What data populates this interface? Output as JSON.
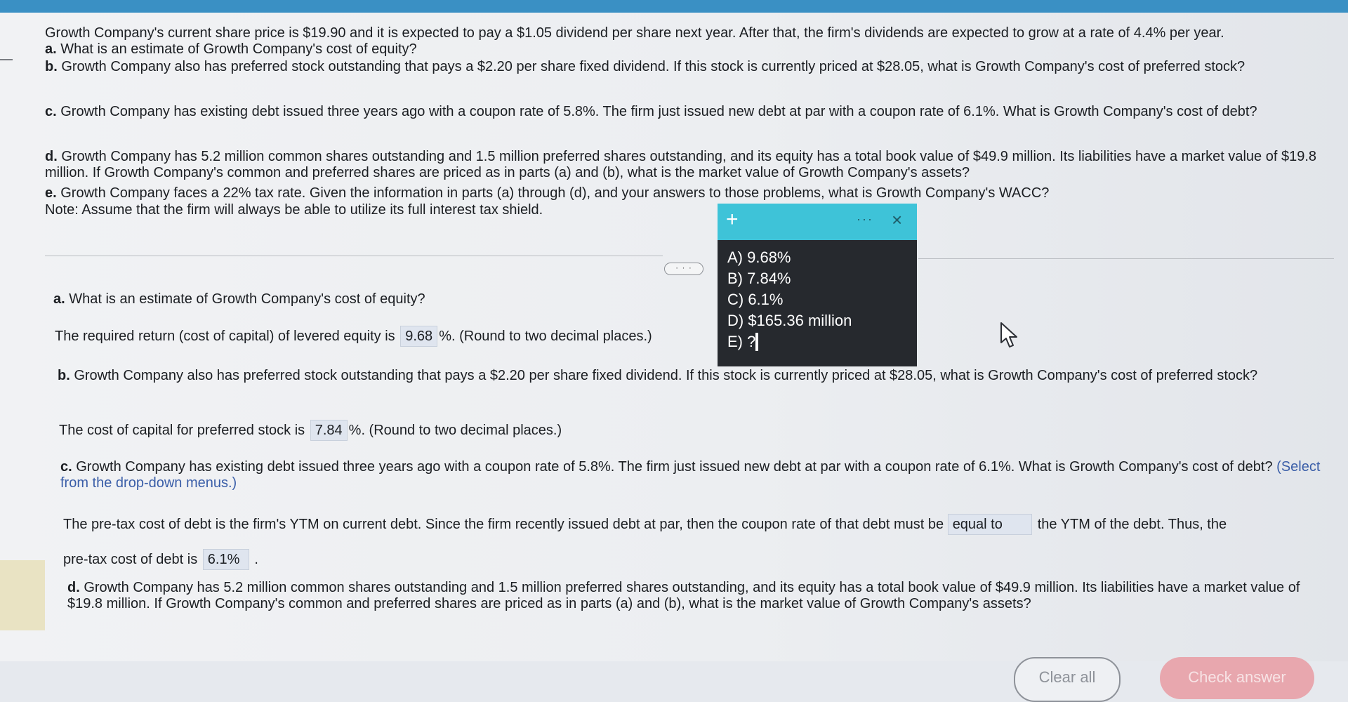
{
  "question": {
    "intro": "Growth Company's current share price is $19.90 and it is expected to pay a $1.05 dividend per share next year. After that, the firm's dividends are expected to grow at a rate of 4.4% per year.",
    "part_a_label": "a.",
    "part_a": "What is an estimate of Growth Company's cost of equity?",
    "part_b_label": "b.",
    "part_b": "Growth Company also has preferred stock outstanding that pays a $2.20 per share fixed dividend. If this stock is currently priced at $28.05, what is Growth Company's cost of preferred stock?",
    "part_c_label": "c.",
    "part_c": "Growth Company has existing debt issued three years ago with a coupon rate of 5.8%. The firm just issued new debt at par with a coupon rate of 6.1%. What is Growth Company's cost of debt?",
    "part_d_label": "d.",
    "part_d": "Growth Company has 5.2 million common shares outstanding and 1.5 million preferred shares outstanding, and its equity has a total book value of $49.9 million. Its liabilities have a market value of $19.8 million. If Growth Company's common and preferred shares are priced as in parts (a) and (b), what is the market value of Growth Company's assets?",
    "part_e_label": "e.",
    "part_e": "Growth Company faces a 22% tax rate. Given the information in parts (a) through (d), and your answers to those problems, what is Growth Company's WACC?",
    "note": "Note: Assume that the firm will always be able to utilize its full interest tax shield."
  },
  "more_pill": "· · ·",
  "answers": {
    "a_label": "a.",
    "a_question": "What is an estimate of Growth Company's cost of equity?",
    "a_prefix": "The required return (cost of capital) of levered equity is",
    "a_value": "9.68",
    "a_suffix": "%.  (Round to two decimal places.)",
    "b_label": "b.",
    "b_question": "Growth Company also has preferred stock outstanding that pays a $2.20 per share fixed dividend. If this stock is currently priced at $28.05, what is Growth Company's cost of preferred stock?",
    "b_prefix": "The cost of capital for preferred stock is",
    "b_value": "7.84",
    "b_suffix": "%.  (Round to two decimal places.)",
    "c_label": "c.",
    "c_question": "Growth Company has existing debt issued three years ago with a coupon rate of 5.8%. The firm just issued new debt at par with a coupon rate of 6.1%. What is Growth Company's cost of debt?",
    "c_instruction": "(Select from the drop-down menus.)",
    "c_line1_prefix": "The pre-tax cost of debt is the firm's YTM on current debt. Since the firm recently issued debt at par, then the coupon rate of that debt must be",
    "c_dropdown1": "equal to",
    "c_line1_suffix": "the YTM of the debt. Thus, the",
    "c_line2_prefix": "pre-tax cost of debt is",
    "c_dropdown2": "6.1%",
    "c_line2_suffix": ".",
    "d_label": "d.",
    "d_question": "Growth Company has 5.2 million common shares outstanding and 1.5 million preferred shares outstanding, and its equity has a total book value of $49.9 million. Its liabilities have a market value of $19.8 million. If Growth Company's common and preferred shares are priced as in parts (a) and (b), what is the market value of Growth Company's assets?"
  },
  "popup": {
    "add_icon": "+",
    "more_icon": "···",
    "close_icon": "×",
    "options": [
      "A) 9.68%",
      "B) 7.84%",
      "C) 6.1%",
      "D) $165.36 million",
      "E) ?"
    ]
  },
  "buttons": {
    "clear_all": "Clear all",
    "check_answer": "Check answer"
  },
  "colors": {
    "popup_header": "#3ec3d8",
    "popup_body": "#26292e",
    "answer_box": "#dfe5ef",
    "check_button": "#e8a7ae"
  }
}
